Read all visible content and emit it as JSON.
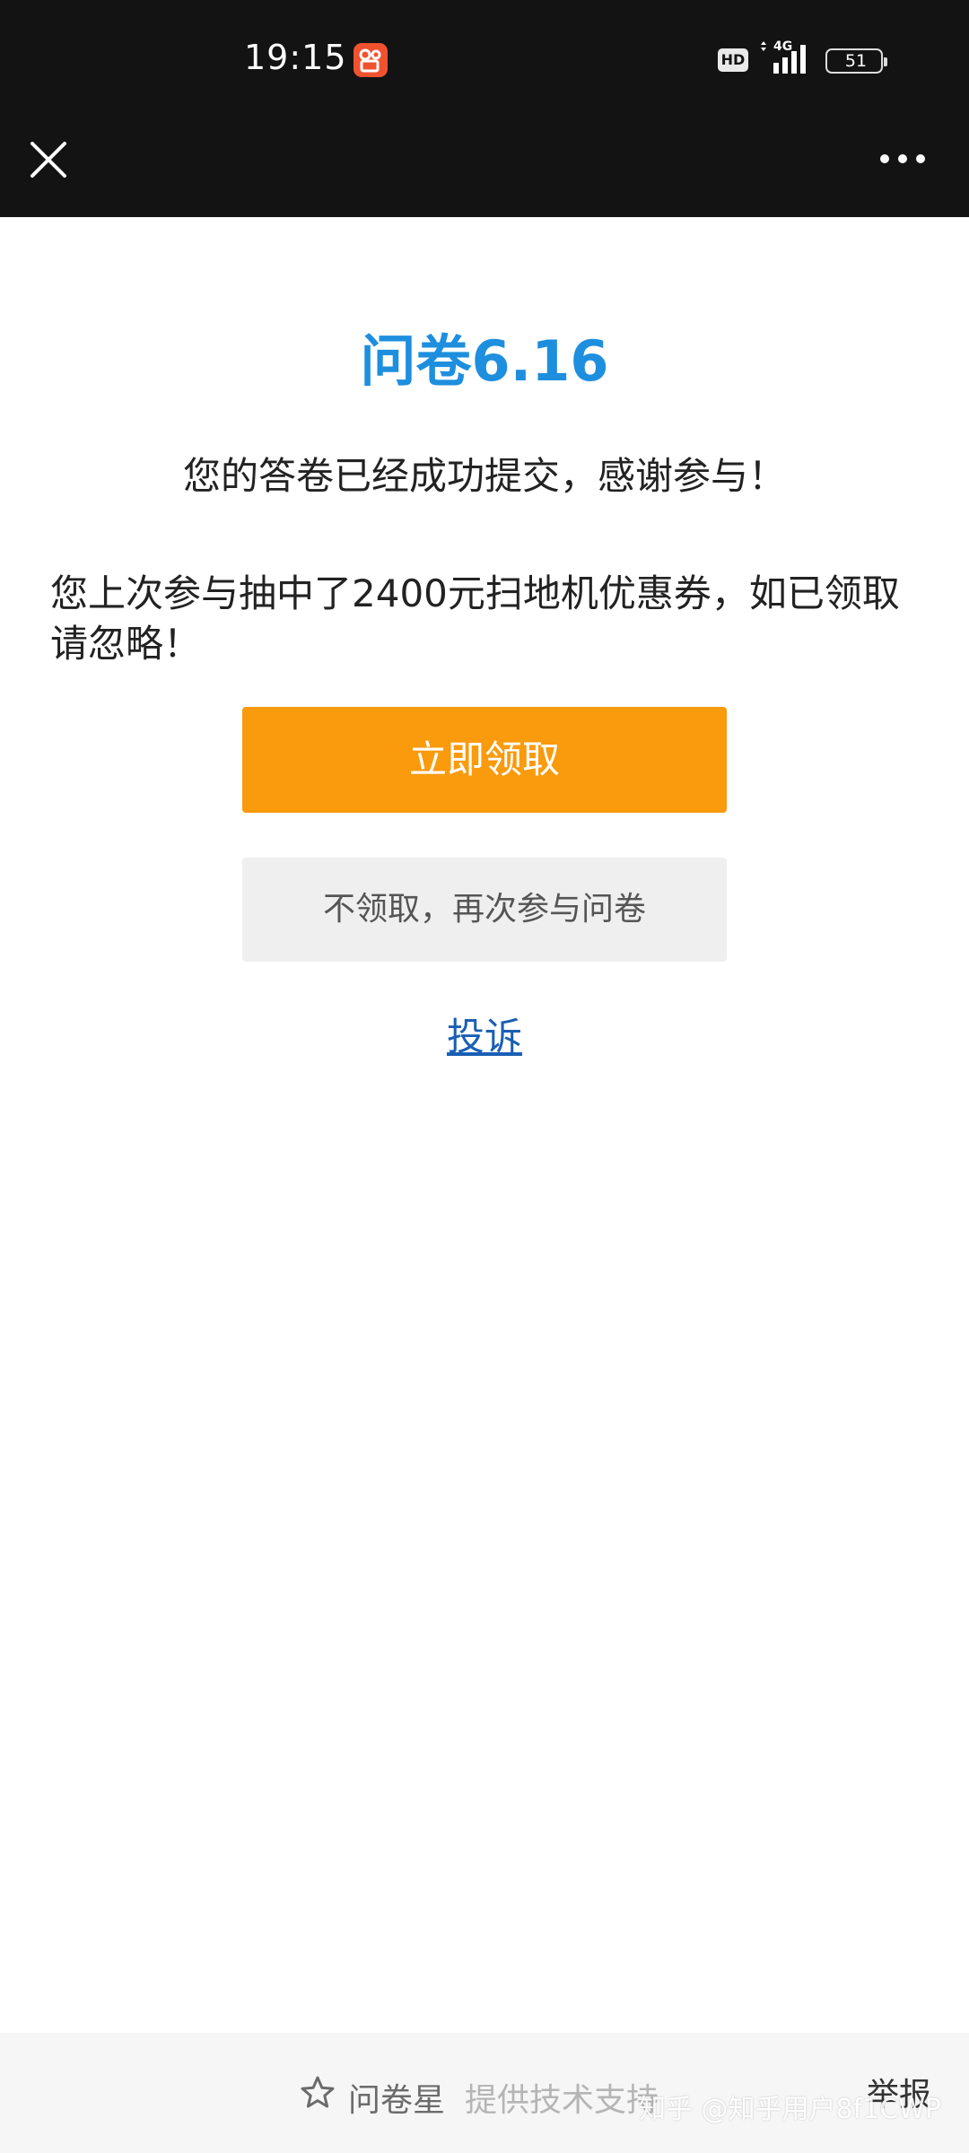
{
  "status_bar": {
    "time": "19:15",
    "hd_label": "HD",
    "network_label": "4G",
    "battery_level": "51",
    "app_icon": "kuaishou-app-icon"
  },
  "nav": {
    "close_icon": "close-icon",
    "more_icon": "more-icon"
  },
  "content": {
    "title": "问卷6.16",
    "success_message": "您的答卷已经成功提交，感谢参与！",
    "notice_message": "您上次参与抽中了2400元扫地机优惠券，如已领取请忽略！",
    "claim_button_label": "立即领取",
    "retry_button_label": "不领取，再次参与问卷",
    "complaint_link_label": "投诉"
  },
  "footer": {
    "brand": "问卷星",
    "support_text": "提供技术支持",
    "report_label": "举报",
    "watermark": "知乎 @知乎用户8f1CWP"
  },
  "colors": {
    "title_blue": "#1e8fde",
    "claim_orange": "#fa9a0d",
    "retry_gray": "#efefef",
    "link_blue": "#1a5fb4",
    "bar_dark": "#131313"
  }
}
